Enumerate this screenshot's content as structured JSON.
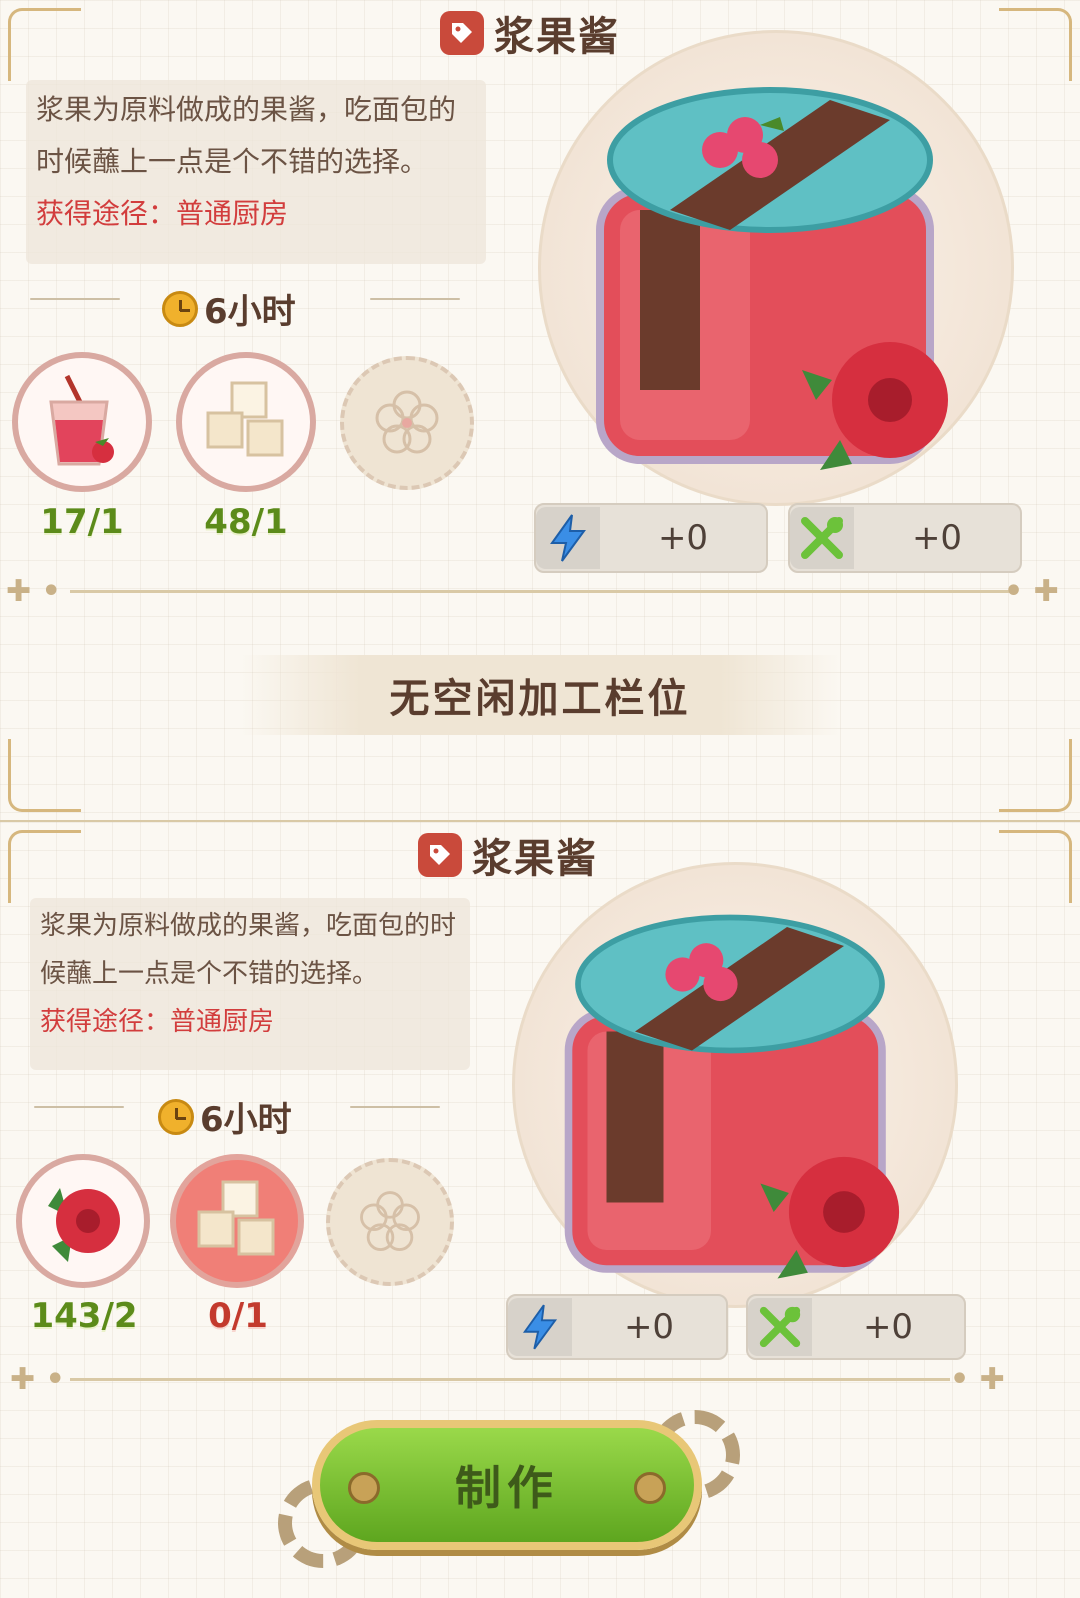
{
  "recipe_top": {
    "title": "浆果酱",
    "description": "浆果为原料做成的果酱，吃面包的时候蘸上一点是个不错的选择。",
    "description_cut": "获得途径：普通厨房",
    "time": "6小时",
    "ingredients": [
      {
        "icon": "berry-drink-icon",
        "count": "17/1"
      },
      {
        "icon": "sugar-cubes-icon",
        "count": "48/1"
      },
      {
        "icon": "empty-slot-flower-icon",
        "count": ""
      }
    ],
    "stats": [
      {
        "icon": "energy-bolt-icon",
        "value": "+0",
        "color": "#3a8ee6"
      },
      {
        "icon": "fork-spoon-icon",
        "value": "+0",
        "color": "#6cc23a"
      }
    ]
  },
  "notice": "无空闲加工栏位",
  "recipe_bottom": {
    "title": "浆果酱",
    "description": "浆果为原料做成的果酱，吃面包的时候蘸上一点是个不错的选择。",
    "description_cut": "获得途径：普通厨房",
    "time": "6小时",
    "ingredients": [
      {
        "icon": "raspberry-icon",
        "count": "143/2"
      },
      {
        "icon": "sugar-cubes-icon",
        "count": "0/1"
      },
      {
        "icon": "empty-slot-flower-icon",
        "count": ""
      }
    ],
    "stats": [
      {
        "icon": "energy-bolt-icon",
        "value": "+0",
        "color": "#3a8ee6"
      },
      {
        "icon": "fork-spoon-icon",
        "value": "+0",
        "color": "#6cc23a"
      }
    ]
  },
  "make_button": "制作",
  "colors": {
    "accent_red": "#c94a3b",
    "count_ok": "#5c8b1a",
    "count_missing": "#c33a2d",
    "button_green": "#6fbf2a"
  }
}
